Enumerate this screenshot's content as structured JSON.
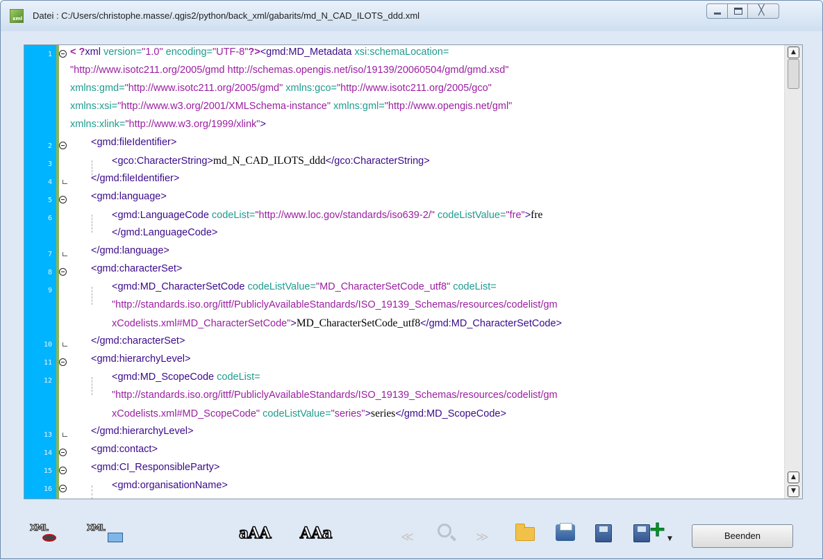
{
  "window": {
    "title": "Datei : C:/Users/christophe.masse/.qgis2/python/back_xml/gabarits/md_N_CAD_ILOTS_ddd.xml",
    "icon": "xml-file-icon",
    "icon_label": "xml",
    "controls": [
      "minimize-icon",
      "maximize-icon",
      "close-icon"
    ],
    "close_glyph": "╳"
  },
  "editor": {
    "line_numbers": [
      "1",
      "2",
      "3",
      "4",
      "5",
      "6",
      "7",
      "8",
      "9",
      "10",
      "11",
      "12",
      "13",
      "14",
      "15",
      "16"
    ],
    "lines": {
      "l1": {
        "pi_open": "< ?",
        "xml": "xml",
        "version_attr": " version=",
        "version_val": "\"1.0\"",
        "enc_attr": " encoding=",
        "enc_val": "\"UTF-8\"",
        "pi_close": "?>",
        "tag": "<gmd:MD_Metadata",
        "schema_attr": " xsi:schemaLocation="
      },
      "l1b": {
        "val": "\"http://www.isotc211.org/2005/gmd http://schemas.opengis.net/iso/19139/20060504/gmd/gmd.xsd\""
      },
      "l1c": {
        "a1": "xmlns:gmd=",
        "v1": "\"http://www.isotc211.org/2005/gmd\"",
        "a2": " xmlns:gco=",
        "v2": "\"http://www.isotc211.org/2005/gco\""
      },
      "l1d": {
        "a1": "xmlns:xsi=",
        "v1": "\"http://www.w3.org/2001/XMLSchema-instance\"",
        "a2": " xmlns:gml=",
        "v2": "\"http://www.opengis.net/gml\""
      },
      "l1e": {
        "a1": "xmlns:xlink=",
        "v1": "\"http://www.w3.org/1999/xlink\"",
        "close": ">"
      },
      "l2": {
        "tag": "<gmd:fileIdentifier>"
      },
      "l3": {
        "open": "<gco:CharacterString>",
        "text": "md_N_CAD_ILOTS_ddd",
        "close": "</gco:CharacterString>"
      },
      "l4": {
        "tag": "</gmd:fileIdentifier>"
      },
      "l5": {
        "tag": "<gmd:language>"
      },
      "l6": {
        "open": "<gmd:LanguageCode",
        "a1": " codeList=",
        "v1": "\"http://www.loc.gov/standards/iso639-2/\"",
        "a2": " codeListValue=",
        "v2": "\"fre\"",
        "gt": ">",
        "text": "fre"
      },
      "l6b": {
        "tag": "</gmd:LanguageCode>"
      },
      "l7": {
        "tag": "</gmd:language>"
      },
      "l8": {
        "tag": "<gmd:characterSet>"
      },
      "l9": {
        "open": "<gmd:MD_CharacterSetCode",
        "a1": " codeListValue=",
        "v1": "\"MD_CharacterSetCode_utf8\"",
        "a2": " codeList="
      },
      "l9b": {
        "val": "\"http://standards.iso.org/ittf/PubliclyAvailableStandards/ISO_19139_Schemas/resources/codelist/gm"
      },
      "l9c": {
        "val": "xCodelists.xml#MD_CharacterSetCode\"",
        "gt": ">",
        "text": "MD_CharacterSetCode_utf8",
        "close": "</gmd:MD_CharacterSetCode>"
      },
      "l10": {
        "tag": "</gmd:characterSet>"
      },
      "l11": {
        "tag": "<gmd:hierarchyLevel>"
      },
      "l12": {
        "open": "<gmd:MD_ScopeCode",
        "a1": " codeList="
      },
      "l12b": {
        "val": "\"http://standards.iso.org/ittf/PubliclyAvailableStandards/ISO_19139_Schemas/resources/codelist/gm"
      },
      "l12c": {
        "val": "xCodelists.xml#MD_ScopeCode\"",
        "a2": " codeListValue=",
        "v2": "\"series\"",
        "gt": ">",
        "text": "series",
        "close": "</gmd:MD_ScopeCode>"
      },
      "l13": {
        "tag": "</gmd:hierarchyLevel>"
      },
      "l14": {
        "tag": "<gmd:contact>"
      },
      "l15": {
        "tag": "<gmd:CI_ResponsibleParty>"
      },
      "l16": {
        "tag": "<gmd:organisationName>"
      }
    }
  },
  "scrollbar": {
    "up_glyph": "▲",
    "down_glyph": "▼"
  },
  "toolbar": {
    "view_xml_icon_label": "XML",
    "xml_display_icon_label": "XML",
    "font_smaller_label": "aAA",
    "font_larger_label": "AAa",
    "prev_glyph": "≪",
    "next_glyph": "≫",
    "add_glyph": "+",
    "add_caret": "▼",
    "close_button_label": "Beenden"
  }
}
